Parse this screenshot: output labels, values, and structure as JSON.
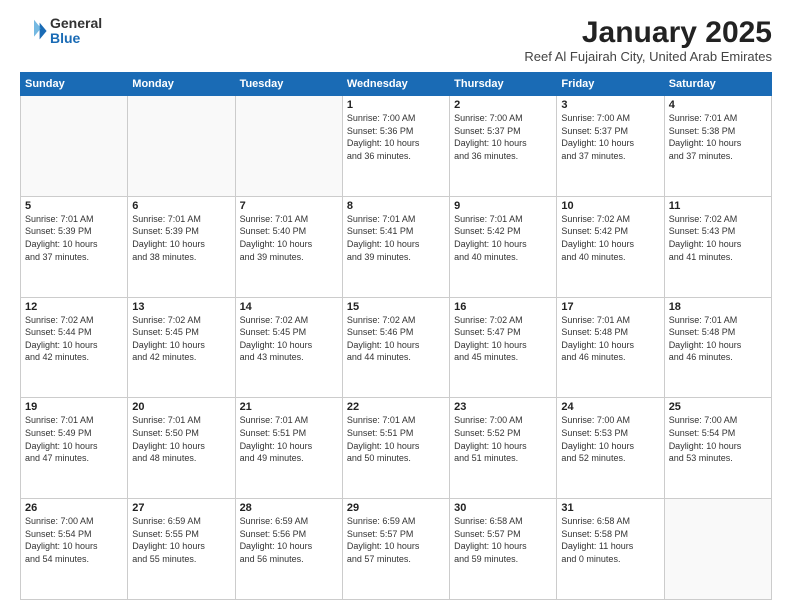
{
  "logo": {
    "general": "General",
    "blue": "Blue"
  },
  "header": {
    "month": "January 2025",
    "location": "Reef Al Fujairah City, United Arab Emirates"
  },
  "weekdays": [
    "Sunday",
    "Monday",
    "Tuesday",
    "Wednesday",
    "Thursday",
    "Friday",
    "Saturday"
  ],
  "weeks": [
    [
      {
        "day": "",
        "info": ""
      },
      {
        "day": "",
        "info": ""
      },
      {
        "day": "",
        "info": ""
      },
      {
        "day": "1",
        "info": "Sunrise: 7:00 AM\nSunset: 5:36 PM\nDaylight: 10 hours\nand 36 minutes."
      },
      {
        "day": "2",
        "info": "Sunrise: 7:00 AM\nSunset: 5:37 PM\nDaylight: 10 hours\nand 36 minutes."
      },
      {
        "day": "3",
        "info": "Sunrise: 7:00 AM\nSunset: 5:37 PM\nDaylight: 10 hours\nand 37 minutes."
      },
      {
        "day": "4",
        "info": "Sunrise: 7:01 AM\nSunset: 5:38 PM\nDaylight: 10 hours\nand 37 minutes."
      }
    ],
    [
      {
        "day": "5",
        "info": "Sunrise: 7:01 AM\nSunset: 5:39 PM\nDaylight: 10 hours\nand 37 minutes."
      },
      {
        "day": "6",
        "info": "Sunrise: 7:01 AM\nSunset: 5:39 PM\nDaylight: 10 hours\nand 38 minutes."
      },
      {
        "day": "7",
        "info": "Sunrise: 7:01 AM\nSunset: 5:40 PM\nDaylight: 10 hours\nand 39 minutes."
      },
      {
        "day": "8",
        "info": "Sunrise: 7:01 AM\nSunset: 5:41 PM\nDaylight: 10 hours\nand 39 minutes."
      },
      {
        "day": "9",
        "info": "Sunrise: 7:01 AM\nSunset: 5:42 PM\nDaylight: 10 hours\nand 40 minutes."
      },
      {
        "day": "10",
        "info": "Sunrise: 7:02 AM\nSunset: 5:42 PM\nDaylight: 10 hours\nand 40 minutes."
      },
      {
        "day": "11",
        "info": "Sunrise: 7:02 AM\nSunset: 5:43 PM\nDaylight: 10 hours\nand 41 minutes."
      }
    ],
    [
      {
        "day": "12",
        "info": "Sunrise: 7:02 AM\nSunset: 5:44 PM\nDaylight: 10 hours\nand 42 minutes."
      },
      {
        "day": "13",
        "info": "Sunrise: 7:02 AM\nSunset: 5:45 PM\nDaylight: 10 hours\nand 42 minutes."
      },
      {
        "day": "14",
        "info": "Sunrise: 7:02 AM\nSunset: 5:45 PM\nDaylight: 10 hours\nand 43 minutes."
      },
      {
        "day": "15",
        "info": "Sunrise: 7:02 AM\nSunset: 5:46 PM\nDaylight: 10 hours\nand 44 minutes."
      },
      {
        "day": "16",
        "info": "Sunrise: 7:02 AM\nSunset: 5:47 PM\nDaylight: 10 hours\nand 45 minutes."
      },
      {
        "day": "17",
        "info": "Sunrise: 7:01 AM\nSunset: 5:48 PM\nDaylight: 10 hours\nand 46 minutes."
      },
      {
        "day": "18",
        "info": "Sunrise: 7:01 AM\nSunset: 5:48 PM\nDaylight: 10 hours\nand 46 minutes."
      }
    ],
    [
      {
        "day": "19",
        "info": "Sunrise: 7:01 AM\nSunset: 5:49 PM\nDaylight: 10 hours\nand 47 minutes."
      },
      {
        "day": "20",
        "info": "Sunrise: 7:01 AM\nSunset: 5:50 PM\nDaylight: 10 hours\nand 48 minutes."
      },
      {
        "day": "21",
        "info": "Sunrise: 7:01 AM\nSunset: 5:51 PM\nDaylight: 10 hours\nand 49 minutes."
      },
      {
        "day": "22",
        "info": "Sunrise: 7:01 AM\nSunset: 5:51 PM\nDaylight: 10 hours\nand 50 minutes."
      },
      {
        "day": "23",
        "info": "Sunrise: 7:00 AM\nSunset: 5:52 PM\nDaylight: 10 hours\nand 51 minutes."
      },
      {
        "day": "24",
        "info": "Sunrise: 7:00 AM\nSunset: 5:53 PM\nDaylight: 10 hours\nand 52 minutes."
      },
      {
        "day": "25",
        "info": "Sunrise: 7:00 AM\nSunset: 5:54 PM\nDaylight: 10 hours\nand 53 minutes."
      }
    ],
    [
      {
        "day": "26",
        "info": "Sunrise: 7:00 AM\nSunset: 5:54 PM\nDaylight: 10 hours\nand 54 minutes."
      },
      {
        "day": "27",
        "info": "Sunrise: 6:59 AM\nSunset: 5:55 PM\nDaylight: 10 hours\nand 55 minutes."
      },
      {
        "day": "28",
        "info": "Sunrise: 6:59 AM\nSunset: 5:56 PM\nDaylight: 10 hours\nand 56 minutes."
      },
      {
        "day": "29",
        "info": "Sunrise: 6:59 AM\nSunset: 5:57 PM\nDaylight: 10 hours\nand 57 minutes."
      },
      {
        "day": "30",
        "info": "Sunrise: 6:58 AM\nSunset: 5:57 PM\nDaylight: 10 hours\nand 59 minutes."
      },
      {
        "day": "31",
        "info": "Sunrise: 6:58 AM\nSunset: 5:58 PM\nDaylight: 11 hours\nand 0 minutes."
      },
      {
        "day": "",
        "info": ""
      }
    ]
  ]
}
